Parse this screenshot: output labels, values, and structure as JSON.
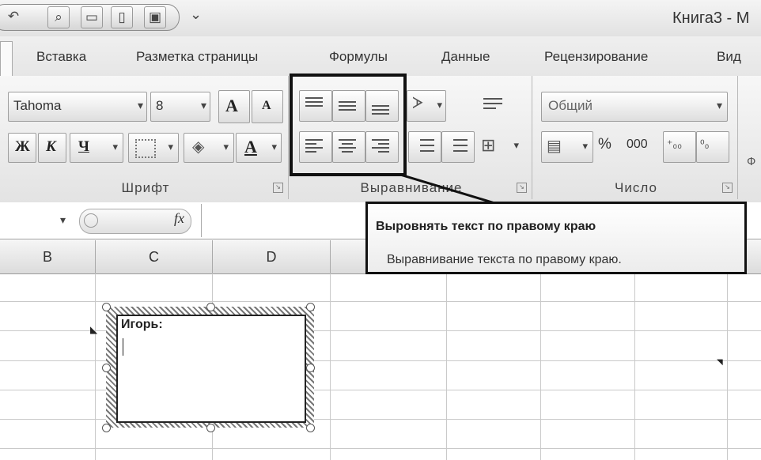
{
  "window": {
    "title": "Книга3 - М"
  },
  "tabs": [
    {
      "label": "Вставка"
    },
    {
      "label": "Разметка страницы"
    },
    {
      "label": "Формулы"
    },
    {
      "label": "Данные"
    },
    {
      "label": "Рецензирование"
    },
    {
      "label": "Вид"
    }
  ],
  "ribbon": {
    "font_group": {
      "label": "Шрифт",
      "font_name": "Tahoma",
      "font_size": "8",
      "grow_font": "A",
      "shrink_font": "A",
      "bold": "Ж",
      "italic": "К",
      "underline": "Ч",
      "font_color": "A"
    },
    "alignment_group": {
      "label": "Выравнивание"
    },
    "number_group": {
      "label": "Число",
      "format_value": "Общий",
      "percent": "%",
      "thousands": "000"
    },
    "styles_group": {
      "label": "Ф"
    }
  },
  "formula_bar": {
    "fx_label": "fx"
  },
  "columns": [
    "B",
    "C",
    "D"
  ],
  "tooltip": {
    "title": "Выровнять текст по правому краю",
    "description": "Выравнивание текста по правому краю."
  },
  "textbox": {
    "text": "Игорь:"
  }
}
